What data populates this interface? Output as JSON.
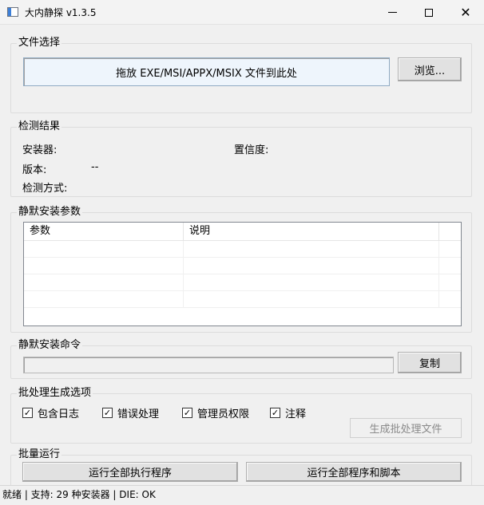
{
  "window": {
    "title": "大内静探 v1.3.5"
  },
  "file_select": {
    "group_title": "文件选择",
    "drop_text": "拖放 EXE/MSI/APPX/MSIX 文件到此处",
    "browse_label": "浏览..."
  },
  "detect": {
    "group_title": "检测结果",
    "installer_label": "安装器:",
    "confidence_label": "置信度:",
    "version_label": "版本:",
    "version_value": "--",
    "method_label": "检测方式:"
  },
  "params": {
    "group_title": "静默安装参数",
    "columns": [
      "参数",
      "说明"
    ]
  },
  "command": {
    "group_title": "静默安装命令",
    "copy_label": "复制"
  },
  "batch": {
    "group_title": "批处理生成选项",
    "options": [
      {
        "label": "包含日志",
        "checked": true
      },
      {
        "label": "错误处理",
        "checked": true
      },
      {
        "label": "管理员权限",
        "checked": true
      },
      {
        "label": "注释",
        "checked": true
      }
    ],
    "generate_label": "生成批处理文件"
  },
  "run": {
    "group_title": "批量运行",
    "run_exe_label": "运行全部执行程序",
    "run_all_label": "运行全部程序和脚本"
  },
  "status": {
    "text": "就绪 | 支持: 29 种安装器 | DIE: OK"
  }
}
